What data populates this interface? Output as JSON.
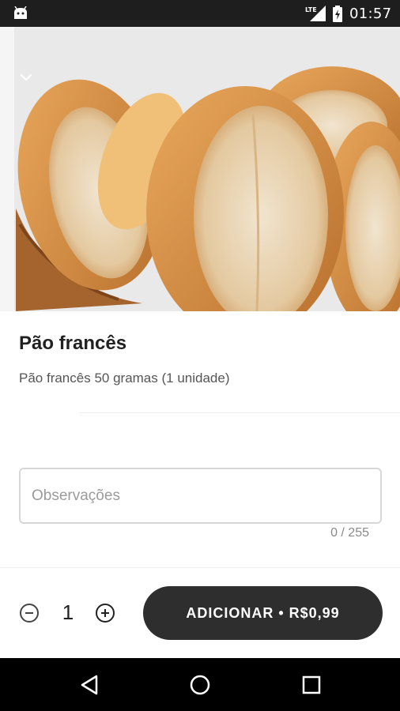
{
  "status_bar": {
    "time": "01:57",
    "network": "LTE",
    "icons": [
      "android-icon",
      "lte-signal-icon",
      "battery-charging-icon"
    ]
  },
  "hero": {
    "image": "french-bread-photo",
    "collapse_icon": "chevron-down-icon"
  },
  "product": {
    "title": "Pão francês",
    "description": "Pão francês 50 gramas (1 unidade)"
  },
  "notes": {
    "placeholder": "Observações",
    "value": "",
    "counter": "0 / 255"
  },
  "order": {
    "quantity": "1",
    "minus_icon": "minus-circle-icon",
    "plus_icon": "plus-circle-icon",
    "add_label": "ADICIONAR • R$0,99"
  },
  "nav": {
    "icons": [
      "back-icon",
      "home-icon",
      "recents-icon"
    ]
  }
}
